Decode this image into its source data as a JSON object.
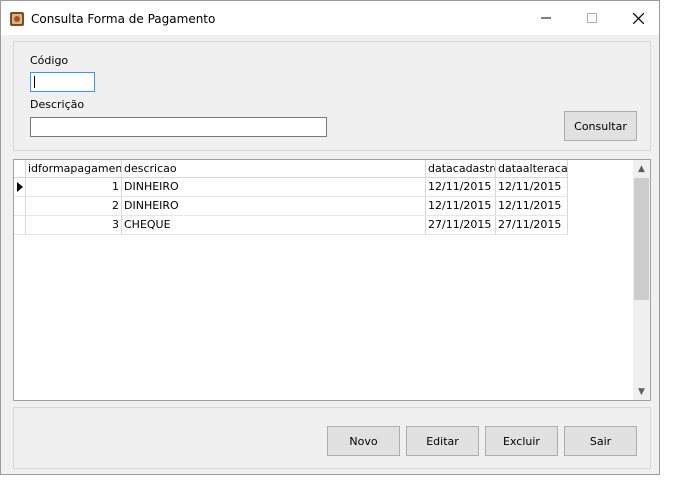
{
  "window": {
    "title": "Consulta Forma de Pagamento",
    "controls": {
      "minimize": "—",
      "maximize": "☐",
      "close": "✕"
    }
  },
  "filters": {
    "codigo_label": "Código",
    "codigo_value": "",
    "descricao_label": "Descrição",
    "descricao_value": "",
    "consultar_label": "Consultar"
  },
  "grid": {
    "columns": [
      "idformapagamento",
      "descricao",
      "datacadastro",
      "dataalteracao"
    ],
    "rows": [
      {
        "idformapagamento": "1",
        "descricao": "DINHEIRO",
        "datacadastro": "12/11/2015",
        "dataalteracao": "12/11/2015",
        "selected": true
      },
      {
        "idformapagamento": "2",
        "descricao": "DINHEIRO",
        "datacadastro": "12/11/2015",
        "dataalteracao": "12/11/2015",
        "selected": false
      },
      {
        "idformapagamento": "3",
        "descricao": "CHEQUE",
        "datacadastro": "27/11/2015",
        "dataalteracao": "27/11/2015",
        "selected": false
      }
    ],
    "scroll_up_icon": "▲",
    "scroll_down_icon": "▼"
  },
  "actions": {
    "novo": "Novo",
    "editar": "Editar",
    "excluir": "Excluir",
    "sair": "Sair"
  }
}
